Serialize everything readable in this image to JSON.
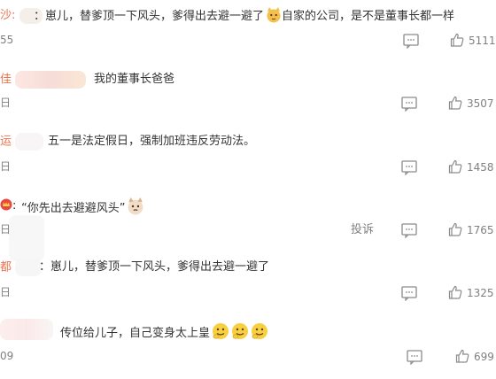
{
  "comments": [
    {
      "user_visible": "沙:",
      "text": "：崽儿，替爹顶一下风头，爹得出去避一避了",
      "text_suffix": "自家的公司，是不是董事长都一样",
      "emoji": [
        "cat-emoji"
      ],
      "time_fragment": "55",
      "likes": "5111"
    },
    {
      "user_visible": "佳",
      "text": "我的董事长爸爸",
      "time_fragment": "日",
      "likes": "3507"
    },
    {
      "user_visible": "运",
      "text": "五一是法定假日，强制加班违反劳动法。",
      "time_fragment": "日",
      "likes": "1458"
    },
    {
      "user_visible": ":",
      "text": "“你先出去避避风头”",
      "emoji": [
        "cat-emoji"
      ],
      "time_fragment": "日",
      "report_label": "投诉",
      "likes": "1765"
    },
    {
      "user_visible": "都",
      "text": "：崽儿，替爹顶一下风头，爹得出去避一避了",
      "time_fragment": "日",
      "likes": "1325"
    },
    {
      "user_visible": "",
      "text": "传位给儿子，自己变身太上皇",
      "emoji": [
        "face-emoji",
        "face-emoji",
        "face-emoji"
      ],
      "time_fragment": "09",
      "likes": "699"
    }
  ],
  "colors": {
    "username": "#eb7350",
    "text": "#333333",
    "meta": "#808080"
  }
}
